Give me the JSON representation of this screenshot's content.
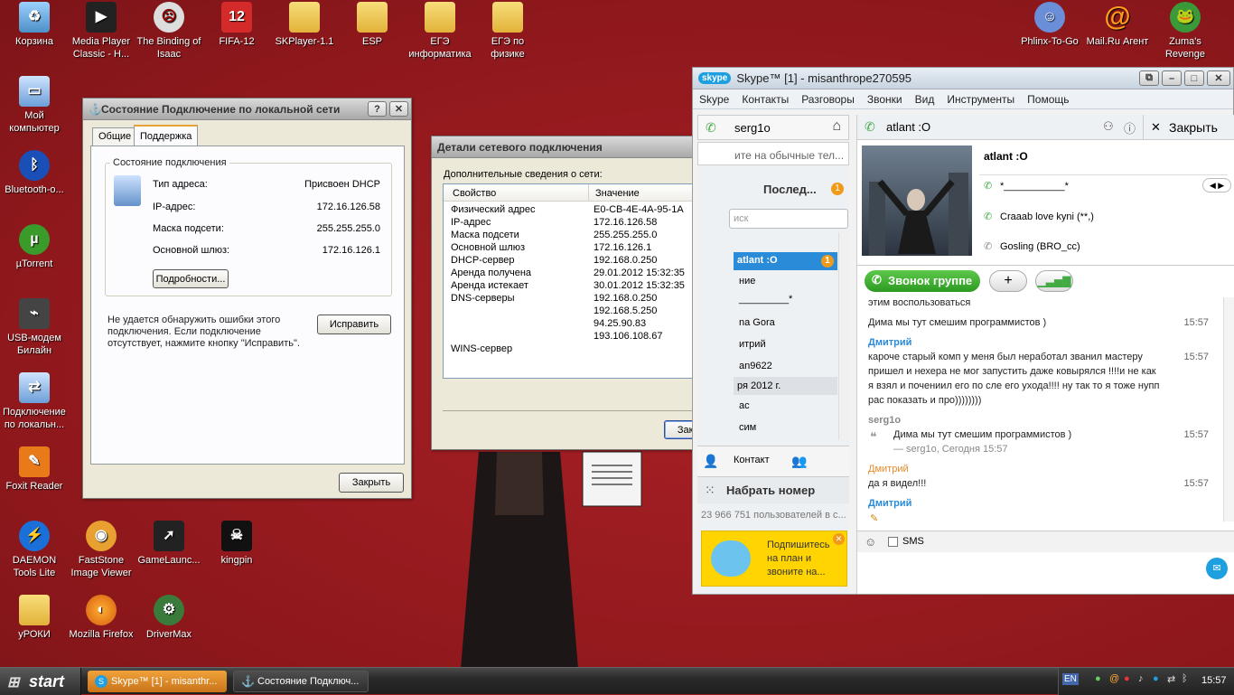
{
  "desktop_icons": [
    {
      "label": "Корзина",
      "icon": "recycle-bin-icon"
    },
    {
      "label": "Media Player Classic - H...",
      "icon": "media-player-icon"
    },
    {
      "label": "The Binding of Isaac",
      "icon": "isaac-icon"
    },
    {
      "label": "FIFA-12",
      "icon": "fifa-icon"
    },
    {
      "label": "SKPlayer-1.1",
      "icon": "folder-icon"
    },
    {
      "label": "ESP",
      "icon": "folder-icon"
    },
    {
      "label": "ЕГЭ информатика",
      "icon": "folder-icon"
    },
    {
      "label": "ЕГЭ по физике",
      "icon": "folder-icon"
    },
    {
      "label": "Phlinx-To-Go",
      "icon": "phlinx-icon"
    },
    {
      "label": "Mail.Ru Агент",
      "icon": "mailru-agent-icon"
    },
    {
      "label": "Zuma's Revenge",
      "icon": "zuma-icon"
    },
    {
      "label": "Мой компьютер",
      "icon": "my-computer-icon"
    },
    {
      "label": "Bluetooth-о...",
      "icon": "bluetooth-icon"
    },
    {
      "label": "µTorrent",
      "icon": "utorrent-icon"
    },
    {
      "label": "USB-модем Билайн",
      "icon": "usb-modem-icon"
    },
    {
      "label": "Подключение по локальн...",
      "icon": "network-connection-icon"
    },
    {
      "label": "Foxit Reader",
      "icon": "foxit-reader-icon"
    },
    {
      "label": "DAEMON Tools Lite",
      "icon": "daemon-tools-icon"
    },
    {
      "label": "FastStone Image Viewer",
      "icon": "faststone-icon"
    },
    {
      "label": "GameLaunc...",
      "icon": "game-launcher-icon"
    },
    {
      "label": "kingpin",
      "icon": "kingpin-icon"
    },
    {
      "label": "уРОКИ",
      "icon": "folder-icon"
    },
    {
      "label": "Mozilla Firefox",
      "icon": "firefox-icon"
    },
    {
      "label": "DriverMax",
      "icon": "drivermax-icon"
    }
  ],
  "status_window": {
    "title": "Состояние Подключение по локальной сети",
    "tabs": [
      "Общие",
      "Поддержка"
    ],
    "active_tab": "Поддержка",
    "group_title": "Состояние подключения",
    "rows": [
      {
        "label": "Тип адреса:",
        "value": "Присвоен DHCP"
      },
      {
        "label": "IP-адрес:",
        "value": "172.16.126.58"
      },
      {
        "label": "Маска подсети:",
        "value": "255.255.255.0"
      },
      {
        "label": "Основной шлюз:",
        "value": "172.16.126.1"
      }
    ],
    "details_button": "Подробности...",
    "diag_text": "Не удается обнаружить ошибки этого подключения. Если подключение отсутствует, нажмите кнопку \"Исправить\".",
    "repair_button": "Исправить",
    "close_button": "Закрыть"
  },
  "details_window": {
    "title": "Детали сетевого подключения",
    "intro": "Дополнительные сведения о сети:",
    "col_property": "Свойство",
    "col_value": "Значение",
    "rows": [
      {
        "p": "Физический адрес",
        "v": "E0-CB-4E-4A-95-1A"
      },
      {
        "p": "IP-адрес",
        "v": "172.16.126.58"
      },
      {
        "p": "Маска подсети",
        "v": "255.255.255.0"
      },
      {
        "p": "Основной шлюз",
        "v": "172.16.126.1"
      },
      {
        "p": "DHCP-сервер",
        "v": "192.168.0.250"
      },
      {
        "p": "Аренда получена",
        "v": "29.01.2012 15:32:35"
      },
      {
        "p": "Аренда истекает",
        "v": "30.01.2012 15:32:35"
      },
      {
        "p": "DNS-серверы",
        "v": "192.168.0.250"
      },
      {
        "p": "",
        "v": "192.168.5.250"
      },
      {
        "p": "",
        "v": "94.25.90.83"
      },
      {
        "p": "",
        "v": "193.106.108.67"
      },
      {
        "p": "WINS-сервер",
        "v": ""
      }
    ],
    "close_button": "Закрыть"
  },
  "skype": {
    "title": "Skype™ [1] - misanthrope270595",
    "menu": [
      "Skype",
      "Контакты",
      "Разговоры",
      "Звонки",
      "Вид",
      "Инструменты",
      "Помощь"
    ],
    "user": "serg1o",
    "mood_text": "ите на обычные тел...",
    "recent_tab": "Послед...",
    "recent_badge": "1",
    "search_placeholder": "иск",
    "contacts": [
      "atlant :O",
      "ние",
      "_________*",
      "na Gora",
      "итрий",
      "an9622",
      "ря 2012 г.",
      "ас",
      "сим"
    ],
    "active_contact_badge": "1",
    "add_contact": "Контакт",
    "dial": "Набрать номер",
    "online_count": "23 966 751 пользователей в с...",
    "ad_text": "Подпишитесь на план и звоните на...",
    "chat_name": "atlant :O",
    "close_chat": "Закрыть",
    "profile_name": "atlant :O",
    "profile_mood": "*___________*",
    "profile_lines": [
      "Craaab love kyni (**,)",
      "Gosling (BRO_cc)"
    ],
    "call_group": "Звонок группе",
    "messages": [
      {
        "author": "",
        "text": "этим воспользоваться",
        "time": ""
      },
      {
        "author": "",
        "text": "Дима мы тут смешим программистов )",
        "time": "15:57"
      },
      {
        "author": "Дмитрий",
        "text": "",
        "time": ""
      },
      {
        "author": "",
        "text": "кароче старый комп у меня был неработал званил мастеру",
        "time": "15:57"
      },
      {
        "author": "",
        "text": "пришел и нехера не мог запустить даже ковырялся !!!!и не как",
        "time": ""
      },
      {
        "author": "",
        "text": "я взял и почениил его по сле его ухода!!!! ну так то я тоже нупп",
        "time": ""
      },
      {
        "author": "",
        "text": "рас показать и про))))))))",
        "time": ""
      },
      {
        "author": "serg1o",
        "text": "",
        "time": ""
      },
      {
        "author": "",
        "text": "Дима мы тут смешим программистов )",
        "time": "15:57"
      },
      {
        "author": "",
        "text": "— serg1o, Сегодня 15:57",
        "time": ""
      },
      {
        "author": "Дмитрий",
        "text": "",
        "time": ""
      },
      {
        "author": "",
        "text": "да я видел!!!",
        "time": "15:57"
      },
      {
        "author": "Дмитрий",
        "text": "",
        "time": ""
      }
    ],
    "sms_label": "SMS"
  },
  "taskbar": {
    "start": "start",
    "tasks": [
      "Skype™ [1] - misanthr...",
      "Состояние Подключ..."
    ],
    "lang": "EN",
    "clock": "15:57"
  }
}
